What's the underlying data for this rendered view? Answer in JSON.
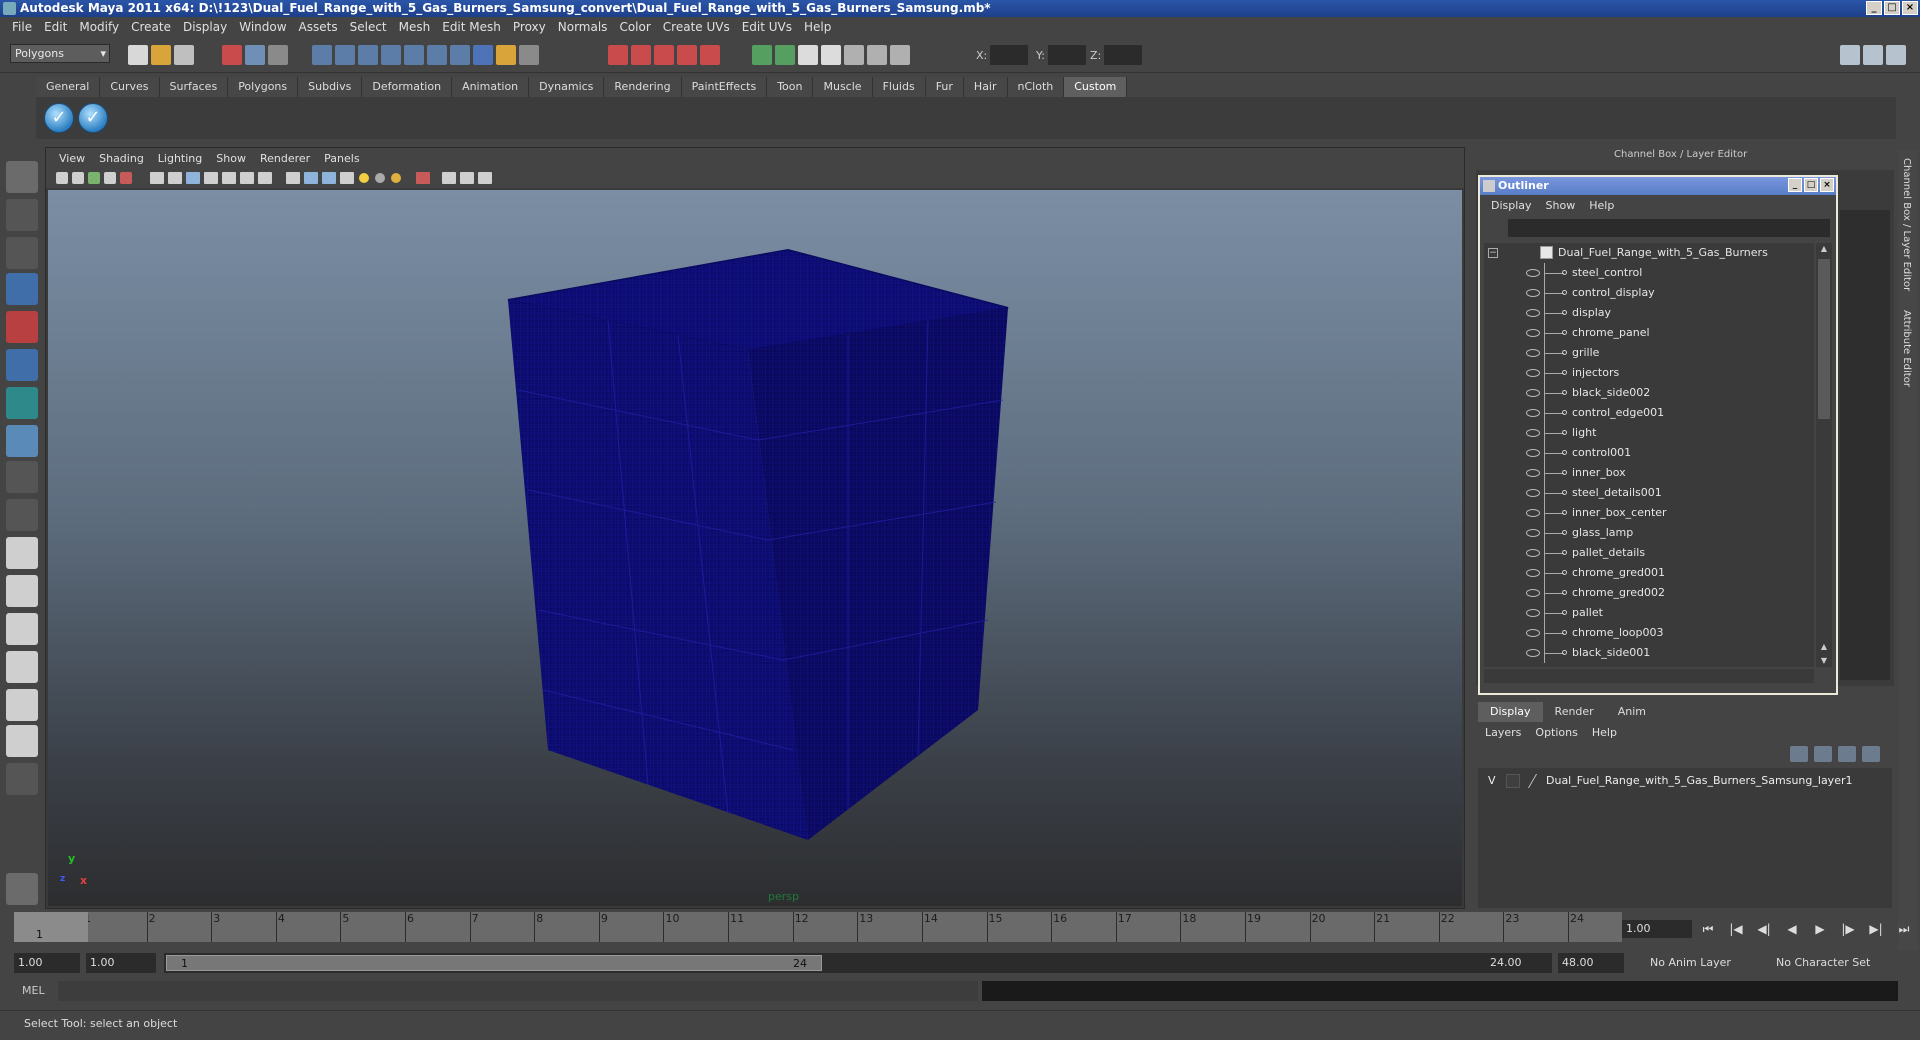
{
  "window": {
    "title": "Autodesk Maya 2011 x64: D:\\!123\\Dual_Fuel_Range_with_5_Gas_Burners_Samsung_convert\\Dual_Fuel_Range_with_5_Gas_Burners_Samsung.mb*"
  },
  "menu": [
    "File",
    "Edit",
    "Modify",
    "Create",
    "Display",
    "Window",
    "Assets",
    "Select",
    "Mesh",
    "Edit Mesh",
    "Proxy",
    "Normals",
    "Color",
    "Create UVs",
    "Edit UVs",
    "Help"
  ],
  "status_line": {
    "mode": "Polygons",
    "x_label": "X:",
    "y_label": "Y:",
    "z_label": "Z:"
  },
  "shelf_tabs": [
    "General",
    "Curves",
    "Surfaces",
    "Polygons",
    "Subdivs",
    "Deformation",
    "Animation",
    "Dynamics",
    "Rendering",
    "PaintEffects",
    "Toon",
    "Muscle",
    "Fluids",
    "Fur",
    "Hair",
    "nCloth",
    "Custom"
  ],
  "shelf_active": "Custom",
  "viewport": {
    "menu": [
      "View",
      "Shading",
      "Lighting",
      "Show",
      "Renderer",
      "Panels"
    ],
    "camera_label": "persp",
    "axis": {
      "x": "x",
      "y": "y",
      "z": "z"
    },
    "wire_color": "#0d0b6e"
  },
  "right_panel": {
    "header": "Channel Box / Layer Editor",
    "vertical_tabs": [
      "Channel Box / Layer Editor",
      "Attribute Editor"
    ]
  },
  "outliner": {
    "title": "Outliner",
    "menu": [
      "Display",
      "Show",
      "Help"
    ],
    "root": "Dual_Fuel_Range_with_5_Gas_Burners",
    "children": [
      "steel_control",
      "control_display",
      "display",
      "chrome_panel",
      "grille",
      "injectors",
      "black_side002",
      "control_edge001",
      "light",
      "control001",
      "inner_box",
      "steel_details001",
      "inner_box_center",
      "glass_lamp",
      "pallet_details",
      "chrome_gred001",
      "chrome_gred002",
      "pallet",
      "chrome_loop003",
      "black_side001"
    ]
  },
  "layer_editor": {
    "tabs": [
      "Display",
      "Render",
      "Anim"
    ],
    "active_tab": "Display",
    "menu": [
      "Layers",
      "Options",
      "Help"
    ],
    "layers": [
      {
        "visible": "V",
        "name": "Dual_Fuel_Range_with_5_Gas_Burners_Samsung_layer1"
      }
    ]
  },
  "time_slider": {
    "ticks": [
      "1",
      "2",
      "3",
      "4",
      "5",
      "6",
      "7",
      "8",
      "9",
      "10",
      "11",
      "12",
      "13",
      "14",
      "15",
      "16",
      "17",
      "18",
      "19",
      "20",
      "21",
      "22",
      "23",
      "24"
    ],
    "current_frame": "1",
    "current_time_field": "1.00"
  },
  "range_slider": {
    "start_time": "1.00",
    "playback_start": "1.00",
    "range_start_label": "1",
    "range_end_label": "24",
    "playback_end": "24.00",
    "end_time": "48.00",
    "anim_layer": "No Anim Layer",
    "character_set": "No Character Set"
  },
  "command_line": {
    "label": "MEL"
  },
  "help_line": "Select Tool: select an object"
}
